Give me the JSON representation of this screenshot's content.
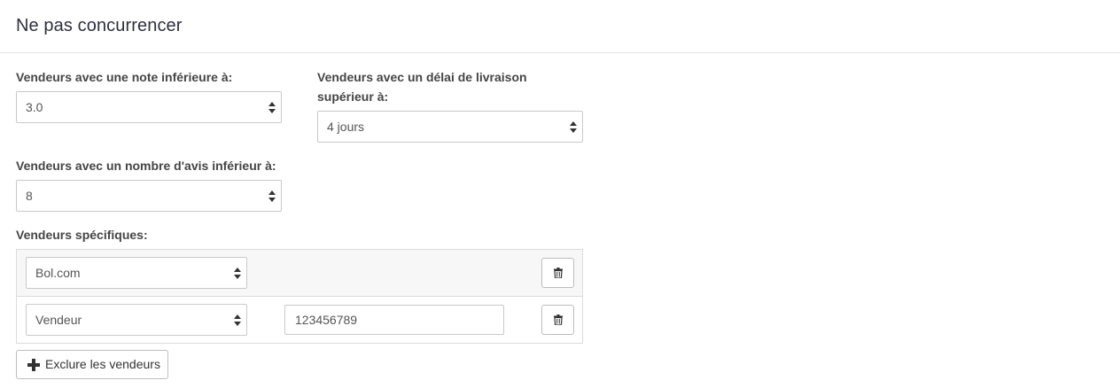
{
  "header": {
    "title": "Ne pas concurrencer"
  },
  "rating": {
    "label": "Vendeurs avec une note inférieure à:",
    "value": "3.0"
  },
  "delivery": {
    "label_line1": "Vendeurs avec un délai de livraison",
    "label_line2": "supérieur à:",
    "value": "4 jours"
  },
  "reviews": {
    "label": "Vendeurs avec un nombre d'avis inférieur à:",
    "value": "8"
  },
  "specific": {
    "label": "Vendeurs spécifiques:",
    "rows": [
      {
        "select": "Bol.com"
      },
      {
        "select": "Vendeur",
        "input": "123456789"
      }
    ]
  },
  "actions": {
    "exclude_label": "Exclure les vendeurs"
  },
  "icons": {
    "trash": "trash-icon",
    "plus": "plus-icon",
    "select_arrows": "sort-arrows-icon"
  }
}
